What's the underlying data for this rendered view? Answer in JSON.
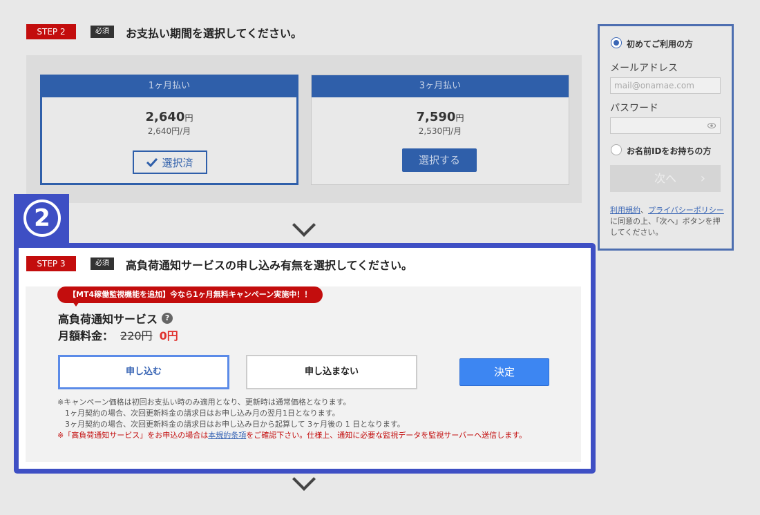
{
  "step2": {
    "step_label": "STEP 2",
    "required_label": "必須",
    "title": "お支払い期間を選択してください。",
    "plans": [
      {
        "name": "1ヶ月払い",
        "price": "2,640",
        "unit": "円",
        "monthly": "2,640円/月",
        "button": "選択済",
        "selected": true
      },
      {
        "name": "3ヶ月払い",
        "price": "7,590",
        "unit": "円",
        "monthly": "2,530円/月",
        "button": "選択する",
        "selected": false
      }
    ]
  },
  "login": {
    "first_time_label": "初めてご利用の方",
    "email_label": "メールアドレス",
    "email_placeholder": "mail@onamae.com",
    "password_label": "パスワード",
    "have_id_label": "お名前IDをお持ちの方",
    "next_button": "次へ",
    "terms_link1": "利用規約",
    "terms_sep": "、",
    "terms_link2": "プライバシーポリシー",
    "terms_text": "に同意の上、「次へ」ボタンを押してください。"
  },
  "badge": {
    "number": "2"
  },
  "step3": {
    "step_label": "STEP 3",
    "required_label": "必須",
    "title": "高負荷通知サービスの申し込み有無を選択してください。",
    "campaign": "【MT4稼働監視機能を追加】今なら1ヶ月無料キャンペーン実施中！！",
    "service_name": "高負荷通知サービス",
    "fee_label": "月額料金：",
    "fee_old": "220円",
    "fee_new": "0円",
    "apply_button": "申し込む",
    "decline_button": "申し込まない",
    "decide_button": "決定",
    "notes": [
      "※キャンペーン価格は初回お支払い時のみ適用となり、更新時は通常価格となります。",
      "1ヶ月契約の場合、次回更新料金の請求日はお申し込み月の翌月1日となります。",
      "3ヶ月契約の場合、次回更新料金の請求日はお申し込み日から起算して 3ヶ月後の 1 日となります。"
    ],
    "note_red_prefix": "※「高負荷通知サービス」をお申込の場合は",
    "note_red_link": "本規約条項",
    "note_red_suffix": "をご確認下さい。仕様上、通知に必要な監視データを監視サーバーへ送信します。"
  },
  "colors": {
    "brand_blue": "#2f5faa",
    "highlight": "#3e4fc4",
    "step_red": "#c30d0d",
    "decide_blue": "#3d86f2",
    "price_red": "#e0312d"
  }
}
